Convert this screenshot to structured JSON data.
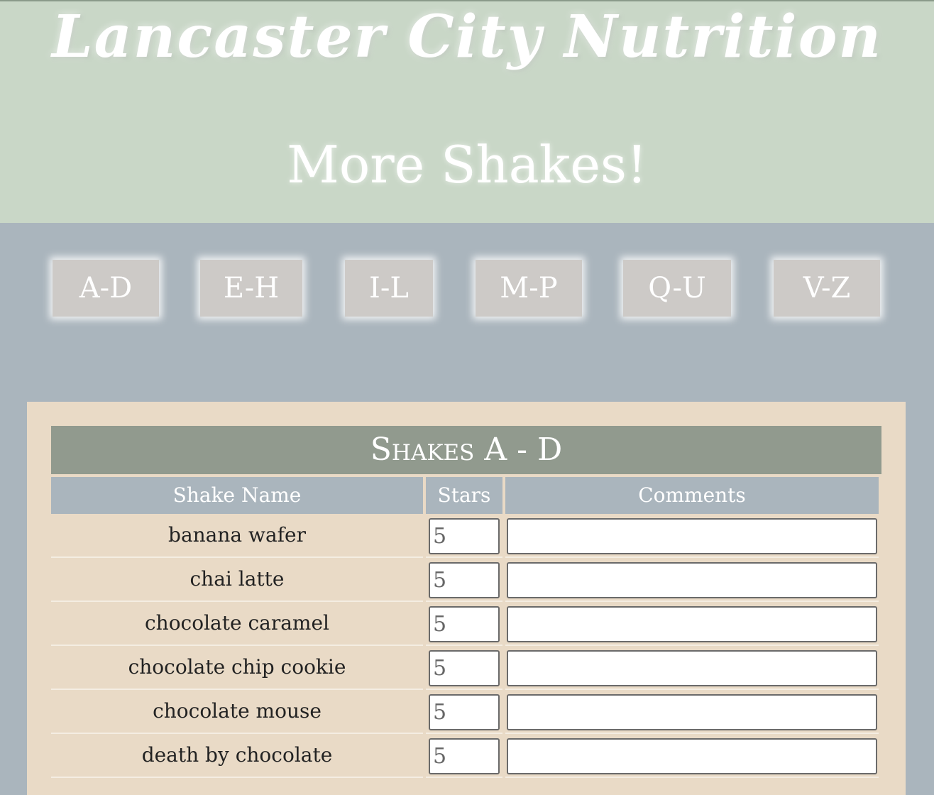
{
  "header": {
    "brand": "Lancaster City Nutrition",
    "subtitle": "More Shakes!"
  },
  "nav": {
    "items": [
      {
        "label": "A-D"
      },
      {
        "label": "E-H"
      },
      {
        "label": "I-L"
      },
      {
        "label": "M-P"
      },
      {
        "label": "Q-U"
      },
      {
        "label": "V-Z"
      }
    ]
  },
  "table": {
    "caption": "Shakes A - D",
    "headers": {
      "name": "Shake Name",
      "stars": "Stars",
      "comments": "Comments"
    },
    "rows": [
      {
        "name": "banana wafer",
        "stars": "5",
        "comment": ""
      },
      {
        "name": "chai latte",
        "stars": "5",
        "comment": ""
      },
      {
        "name": "chocolate caramel",
        "stars": "5",
        "comment": ""
      },
      {
        "name": "chocolate chip cookie",
        "stars": "5",
        "comment": ""
      },
      {
        "name": "chocolate mouse",
        "stars": "5",
        "comment": ""
      },
      {
        "name": "death by chocolate",
        "stars": "5",
        "comment": ""
      }
    ]
  }
}
